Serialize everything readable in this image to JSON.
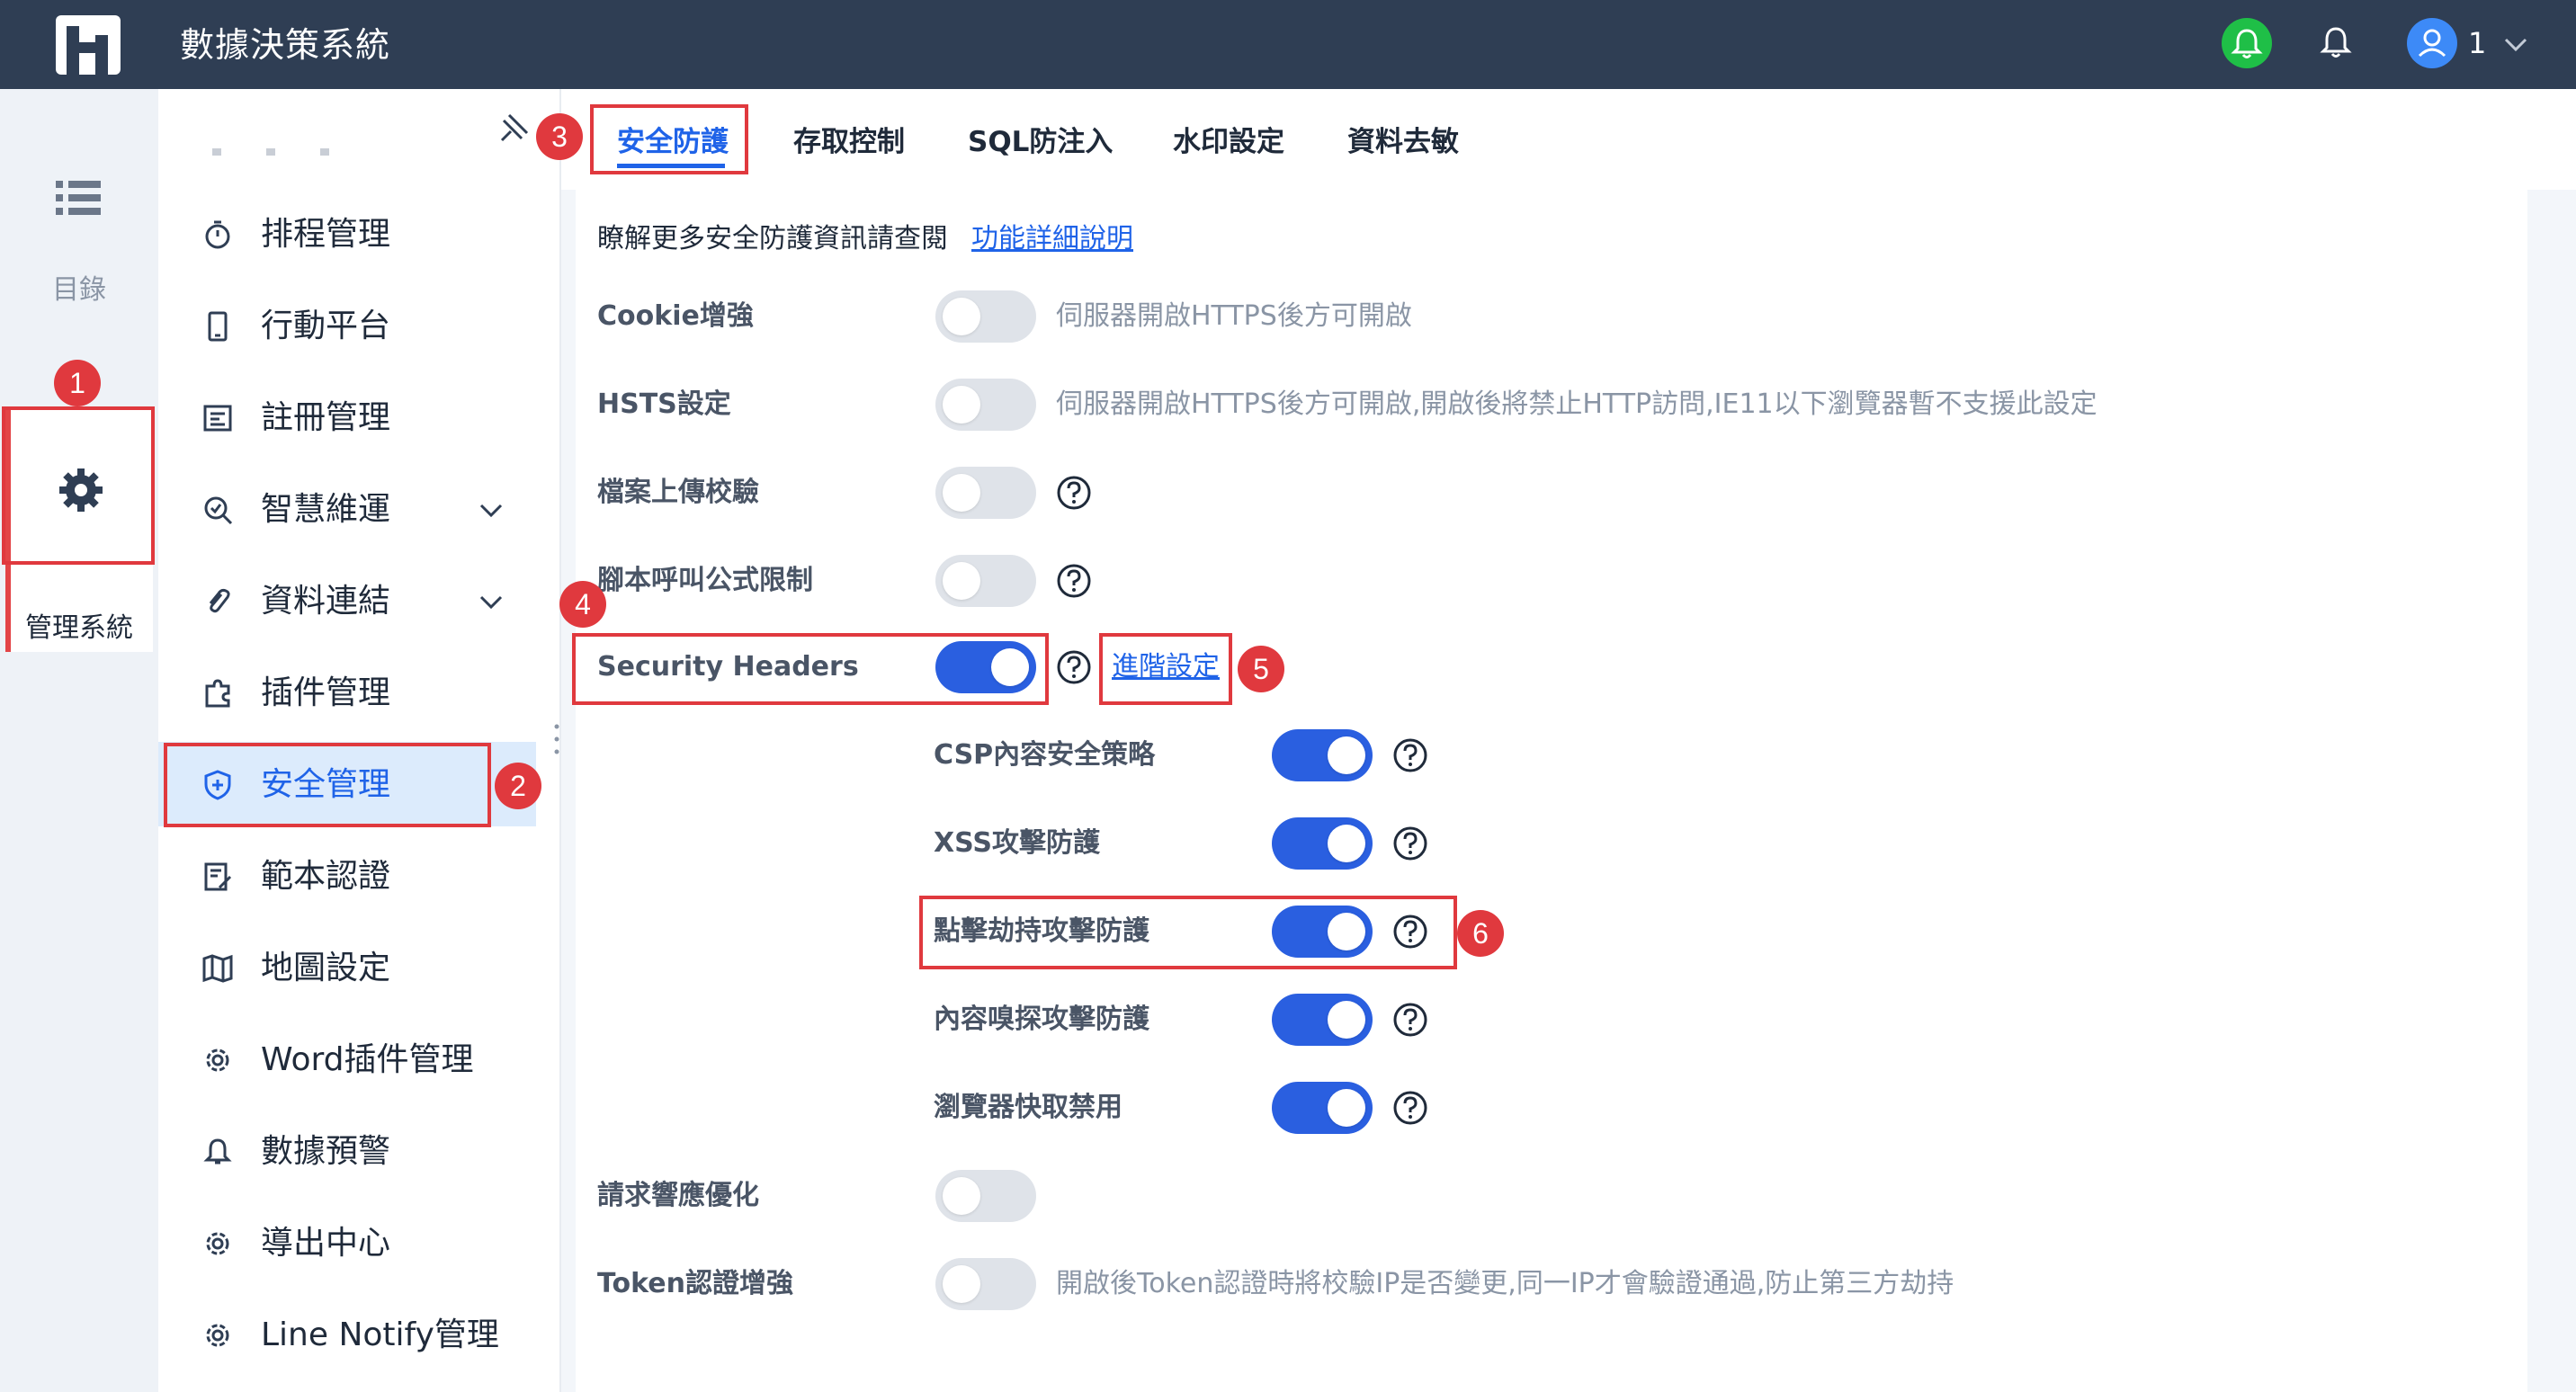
{
  "header": {
    "app_title": "數據決策系統",
    "user_label": "1"
  },
  "rail": {
    "menu_label": "目錄",
    "mgmt_label": "管理系統"
  },
  "sidebar": {
    "items": [
      {
        "label": "排程管理",
        "icon": "timer-icon"
      },
      {
        "label": "行動平台",
        "icon": "mobile-icon"
      },
      {
        "label": "註冊管理",
        "icon": "registration-icon"
      },
      {
        "label": "智慧維運",
        "icon": "operations-icon"
      },
      {
        "label": "資料連結",
        "icon": "link-icon"
      },
      {
        "label": "插件管理",
        "icon": "plugin-icon"
      },
      {
        "label": "安全管理",
        "icon": "shield-icon"
      },
      {
        "label": "範本認證",
        "icon": "template-icon"
      },
      {
        "label": "地圖設定",
        "icon": "map-icon"
      },
      {
        "label": "Word插件管理",
        "icon": "gear-icon"
      },
      {
        "label": "數據預警",
        "icon": "bell-icon"
      },
      {
        "label": "導出中心",
        "icon": "gear-icon"
      },
      {
        "label": "Line Notify管理",
        "icon": "gear-icon"
      }
    ]
  },
  "tabs": [
    "安全防護",
    "存取控制",
    "SQL防注入",
    "水印設定",
    "資料去敏"
  ],
  "info": {
    "text": "瞭解更多安全防護資訊請查閱",
    "link": "功能詳細說明"
  },
  "settings": [
    {
      "label": "Cookie增強",
      "enabled": false,
      "desc": "伺服器開啟HTTPS後方可開啟"
    },
    {
      "label": "HSTS設定",
      "enabled": false,
      "desc": "伺服器開啟HTTPS後方可開啟,開啟後將禁止HTTP訪問,IE11以下瀏覽器暫不支援此設定"
    },
    {
      "label": "檔案上傳校驗",
      "enabled": false
    },
    {
      "label": "腳本呼叫公式限制",
      "enabled": false
    },
    {
      "label": "Security Headers",
      "enabled": true,
      "link": "進階設定"
    },
    {
      "label": "請求響應優化",
      "enabled": false
    },
    {
      "label": "Token認證增強",
      "enabled": false,
      "desc": "開啟後Token認證時將校驗IP是否變更,同一IP才會驗證通過,防止第三方劫持"
    }
  ],
  "sub_settings": [
    {
      "label": "CSP內容安全策略",
      "enabled": true
    },
    {
      "label": "XSS攻擊防護",
      "enabled": true
    },
    {
      "label": "點擊劫持攻擊防護",
      "enabled": true
    },
    {
      "label": "內容嗅探攻擊防護",
      "enabled": true
    },
    {
      "label": "瀏覽器快取禁用",
      "enabled": true
    }
  ],
  "annotations": [
    "1",
    "2",
    "3",
    "4",
    "5",
    "6"
  ],
  "colors": {
    "header_bg": "#2f3e54",
    "accent": "#1f63e8",
    "toggle_on": "#2a5fe0",
    "annotation_red": "#e0393e"
  }
}
